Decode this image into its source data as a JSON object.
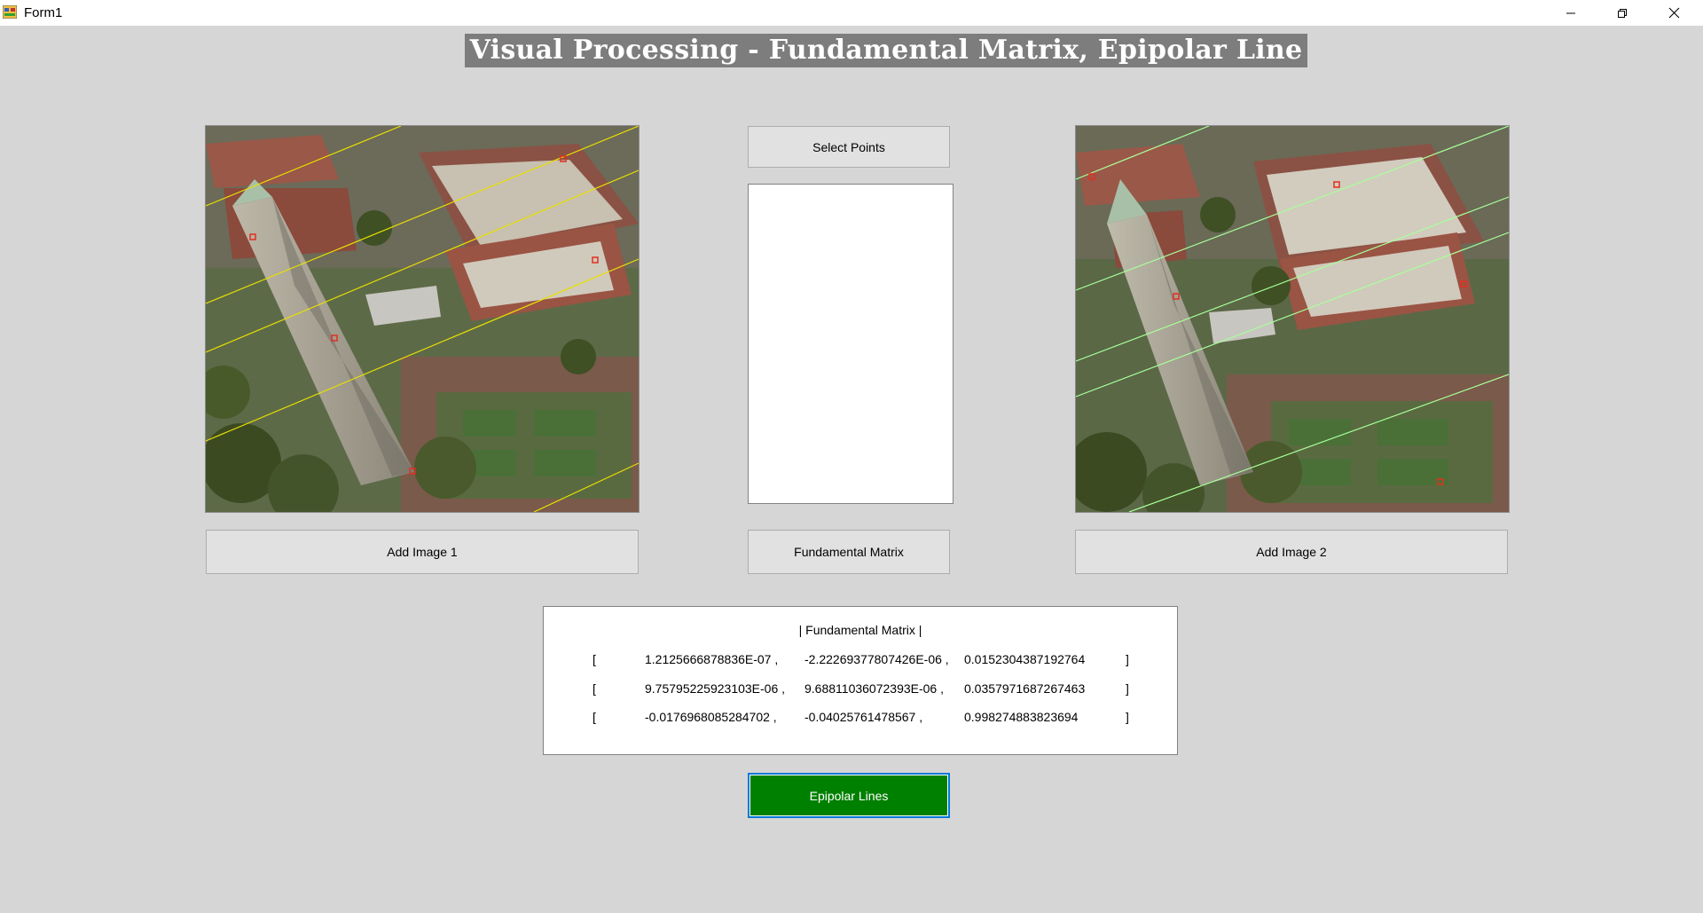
{
  "window": {
    "title": "Form1",
    "controls": {
      "minimize": "minimize-icon",
      "restore": "restore-icon",
      "close": "close-icon"
    }
  },
  "heading": "Visual Processing - Fundamental Matrix, Epipolar Line",
  "left_panel": {
    "image_alt": "Aerial view of bell tower with yellow epipolar lines",
    "line_color": "#e8e000",
    "button_label": "Add Image 1"
  },
  "center_panel": {
    "select_points_label": "Select Points",
    "fundamental_button_label": "Fundamental Matrix"
  },
  "right_panel": {
    "image_alt": "Aerial view of bell tower with green epipolar lines",
    "line_color": "#a8ff9a",
    "button_label": "Add Image 2"
  },
  "matrix": {
    "title": "| Fundamental Matrix |",
    "rows": [
      {
        "open": "[",
        "a": "1.2125666878836E-07 ,",
        "b": "-2.22269377807426E-06 ,",
        "c": "0.0152304387192764",
        "close": "]"
      },
      {
        "open": "[",
        "a": "9.75795225923103E-06 ,",
        "b": "9.68811036072393E-06 ,",
        "c": "0.0357971687267463",
        "close": "]"
      },
      {
        "open": "[",
        "a": "-0.0176968085284702 ,",
        "b": "-0.04025761478567 ,",
        "c": "0.998274883823694",
        "close": "]"
      }
    ]
  },
  "epipolar_button_label": "Epipolar Lines",
  "colors": {
    "background": "#d6d6d6",
    "accent_green": "#008000",
    "focus_blue": "#0078d7",
    "marker_red": "#e03020"
  }
}
